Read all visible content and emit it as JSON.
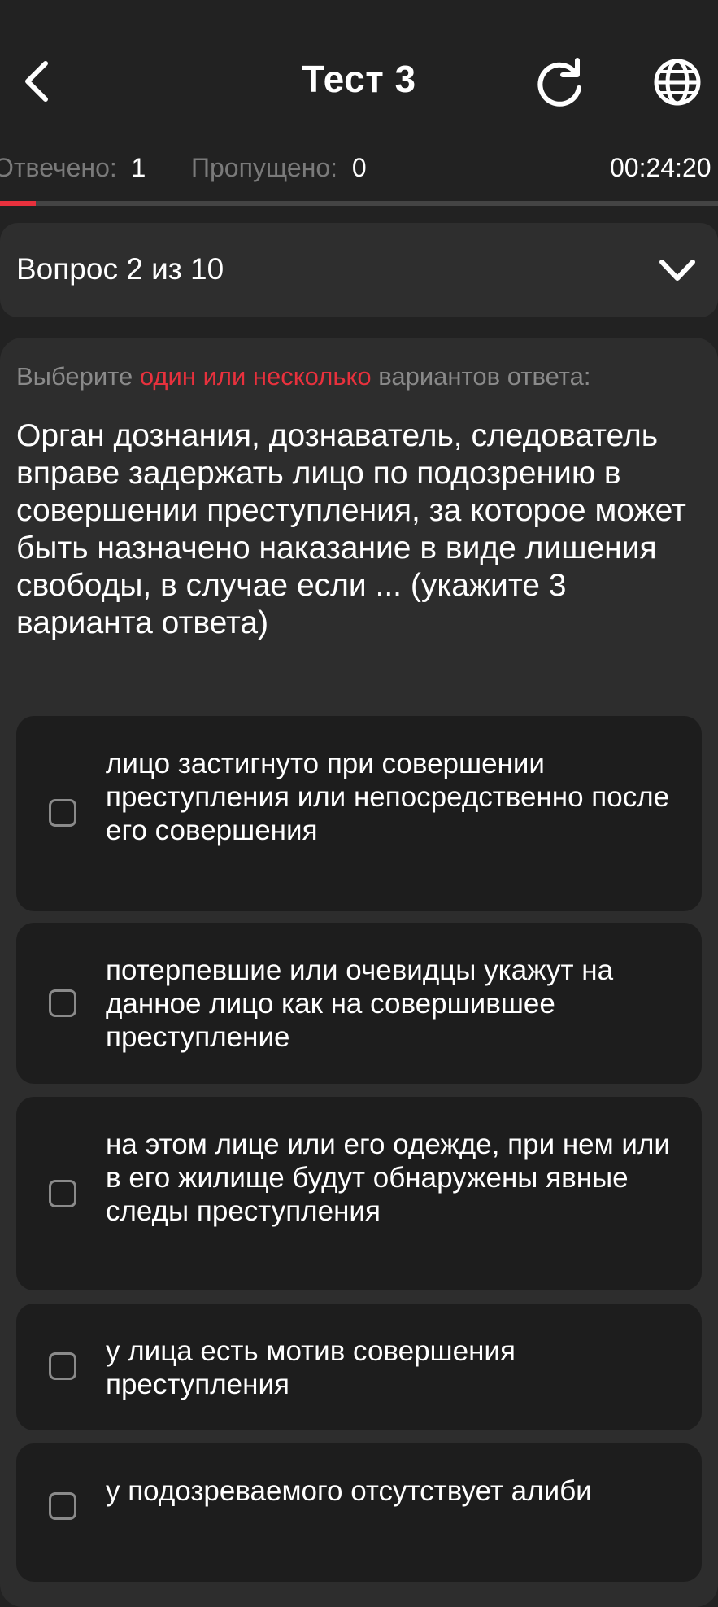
{
  "header": {
    "title": "Тест 3",
    "icons": {
      "back": "chevron-left-icon",
      "reload": "reload-icon",
      "language": "globe-icon"
    }
  },
  "stats": {
    "answered_label": "Отвечено:",
    "answered_value": "1",
    "skipped_label": "Пропущено:",
    "skipped_value": "0",
    "timer": "00:24:20"
  },
  "progress": {
    "fraction": 0.05,
    "color": "#e8313d"
  },
  "question_selector": {
    "label": "Вопрос 2 из 10",
    "icon": "chevron-down-icon"
  },
  "question": {
    "instruction_prefix": "Выберите ",
    "instruction_accent": "один или несколько",
    "instruction_suffix": " вариантов ответа:",
    "text": "Орган дознания, дознаватель, следователь вправе задержать лицо по подозрению в совершении преступления, за которое может быть назначено наказание в виде лишения свободы, в случае если ... (укажите 3 варианта ответа)"
  },
  "options": [
    {
      "text": "лицо застигнуто при совершении преступления или непосредственно после его совершения",
      "checked": false
    },
    {
      "text": "потерпевшие или очевидцы укажут на данное лицо как на совершившее преступление",
      "checked": false
    },
    {
      "text": "на этом лице или его одежде, при нем или в его жилище будут обнаружены явные следы преступления",
      "checked": false
    },
    {
      "text": "у лица есть мотив совершения преступления",
      "checked": false
    },
    {
      "text": "у подозреваемого отсутствует алиби",
      "checked": false
    }
  ],
  "colors": {
    "accent": "#e8313d",
    "background": "#222222",
    "card": "#1d1d1d"
  }
}
